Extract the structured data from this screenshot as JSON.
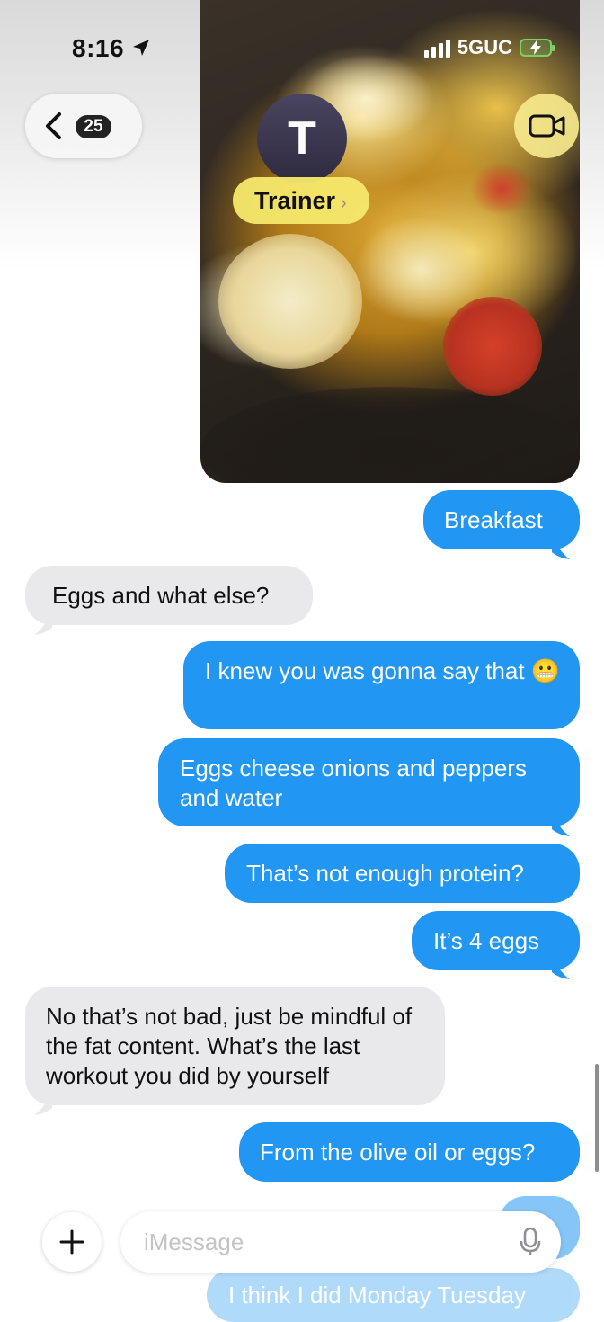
{
  "status_bar": {
    "time": "8:16",
    "network": "5GUC"
  },
  "header": {
    "back_count": "25",
    "contact_initial": "T",
    "contact_name": "Trainer"
  },
  "messages": [
    {
      "direction": "out",
      "text": "Breakfast"
    },
    {
      "direction": "in",
      "text": "Eggs and what else?"
    },
    {
      "direction": "out",
      "text": "I knew you was gonna say that 😬"
    },
    {
      "direction": "out",
      "text": "Eggs cheese onions and peppers and water"
    },
    {
      "direction": "out",
      "text": "That’s not enough protein?"
    },
    {
      "direction": "out",
      "text": "It’s 4 eggs"
    },
    {
      "direction": "in",
      "text": "No that’s not bad, just be mindful of the fat content. What’s the last workout you did by yourself"
    },
    {
      "direction": "out",
      "text": "From the olive oil or eggs?"
    },
    {
      "direction": "out",
      "text": "I think I did Monday Tuesday"
    }
  ],
  "composer": {
    "placeholder": "iMessage"
  },
  "icons": {
    "location": "location-arrow-icon",
    "back": "chevron-left-icon",
    "video": "video-camera-icon",
    "plus": "plus-icon",
    "mic": "microphone-icon"
  },
  "colors": {
    "outgoing": "#2196f3",
    "incoming": "#e9e9eb",
    "contact_pill": "#f6e86c"
  }
}
